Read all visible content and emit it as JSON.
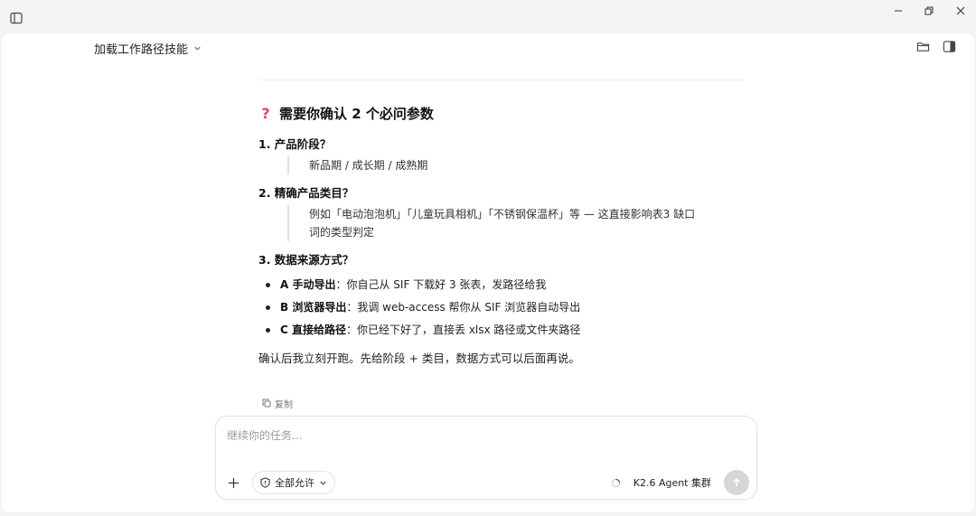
{
  "header": {
    "title": "加载工作路径技能"
  },
  "message": {
    "heading": "需要你确认 2 个必问参数",
    "items": [
      {
        "title": "1. 产品阶段？",
        "detail": "新品期 / 成长期 / 成熟期"
      },
      {
        "title": "2. 精确产品类目？",
        "detail_line1": "例如「电动泡泡机」「儿童玩具相机」「不锈钢保温杯」等 — 这直接影响表3 缺口",
        "detail_line2": "词的类型判定"
      },
      {
        "title": "3. 数据来源方式？"
      }
    ],
    "options": [
      {
        "label": "A 手动导出",
        "sep": "：",
        "text": "你自己从 SIF 下载好 3 张表，发路径给我"
      },
      {
        "label": "B 浏览器导出",
        "sep": "：",
        "text": "我调 web-access 帮你从 SIF 浏览器自动导出"
      },
      {
        "label": "C 直接给路径",
        "sep": "：",
        "text": "你已经下好了，直接丢 xlsx 路径或文件夹路径"
      }
    ],
    "final": "确认后我立刻开跑。先给阶段 + 类目，数据方式可以后面再说。",
    "copy_label": "复制"
  },
  "composer": {
    "placeholder": "继续你的任务...",
    "permission_label": "全部允许",
    "agent_label": "K2.6 Agent 集群"
  },
  "colors": {
    "accent_qmark": "#d9485f",
    "send_disabled": "#d6d6d6"
  },
  "icons": [
    "sidebar-toggle-icon",
    "minimize-icon",
    "restore-icon",
    "close-icon",
    "chevron-down-icon",
    "folder-icon",
    "split-panel-icon",
    "question-mark-icon",
    "copy-icon",
    "plus-icon",
    "shield-icon",
    "spinner-icon",
    "arrow-up-icon"
  ]
}
